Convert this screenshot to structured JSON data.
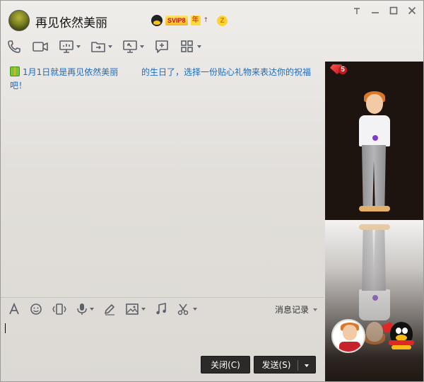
{
  "window": {
    "contact_name": "再见依然美丽",
    "badges": {
      "svip": "SVIP8",
      "year": "年",
      "arrow": "↑",
      "z": "Z"
    },
    "controls": [
      "pin",
      "minimize",
      "maximize",
      "close"
    ]
  },
  "toolbar": {
    "items": [
      {
        "name": "phone-icon"
      },
      {
        "name": "video-icon"
      },
      {
        "name": "screen-share-icon",
        "has_menu": true
      },
      {
        "name": "file-transfer-icon",
        "has_menu": true
      },
      {
        "name": "remote-desktop-icon",
        "has_menu": true
      },
      {
        "name": "new-discussion-icon"
      },
      {
        "name": "apps-icon",
        "has_menu": true
      }
    ]
  },
  "notice": {
    "prefix": "1月1日就是再见依然美丽",
    "suffix": "的生日了，选择一份贴心礼物来表达你的祝福吧！"
  },
  "input_toolbar": {
    "items": [
      {
        "name": "font-icon"
      },
      {
        "name": "emoji-icon"
      },
      {
        "name": "shake-icon"
      },
      {
        "name": "microphone-icon",
        "has_menu": true
      },
      {
        "name": "handwriting-icon"
      },
      {
        "name": "image-icon",
        "has_menu": true
      },
      {
        "name": "music-icon"
      },
      {
        "name": "screenshot-icon",
        "has_menu": true
      }
    ],
    "history_label": "消息记录"
  },
  "buttons": {
    "close_label": "关闭(C)",
    "send_label": "发送(S)"
  },
  "side_panel": {
    "vip_level": "5"
  },
  "colors": {
    "notice_text": "#1f6bb8",
    "button_bg": "#2b2a28",
    "side_panel_bg": "#1f1712"
  }
}
